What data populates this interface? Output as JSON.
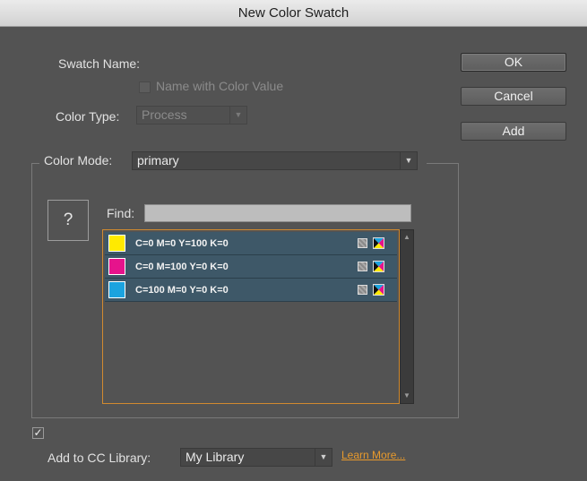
{
  "window": {
    "title": "New Color Swatch"
  },
  "swatch_name": {
    "label": "Swatch Name:",
    "name_with_color_value_label": "Name with Color Value",
    "name_with_color_value_checked": false
  },
  "color_type": {
    "label": "Color Type:",
    "value": "Process"
  },
  "buttons": {
    "ok": "OK",
    "cancel": "Cancel",
    "add": "Add"
  },
  "color_mode": {
    "label": "Color Mode:",
    "value": "primary"
  },
  "preview": {
    "symbol": "?"
  },
  "find": {
    "label": "Find:",
    "value": ""
  },
  "swatches": [
    {
      "name": "C=0 M=0 Y=100 K=0",
      "color": "#ffea00"
    },
    {
      "name": "C=0 M=100 Y=0 K=0",
      "color": "#e6138c"
    },
    {
      "name": "C=100 M=0 Y=0 K=0",
      "color": "#1ba3df"
    }
  ],
  "cc_library": {
    "checked": true,
    "check_mark": "✓",
    "label": "Add to CC Library:",
    "value": "My Library",
    "learn_more": "Learn More..."
  },
  "icons": {
    "dropdown": "triangle-down-icon",
    "process_type": "process-type-icon",
    "cmyk_mode": "cmyk-mode-icon",
    "scroll_up": "scroll-up-arrow-icon",
    "scroll_down": "scroll-down-arrow-icon"
  },
  "colors": {
    "dialog_bg": "#535353",
    "selection_row": "#3e5868",
    "list_focus_border": "#d28a2f",
    "link": "#e89a2c"
  }
}
